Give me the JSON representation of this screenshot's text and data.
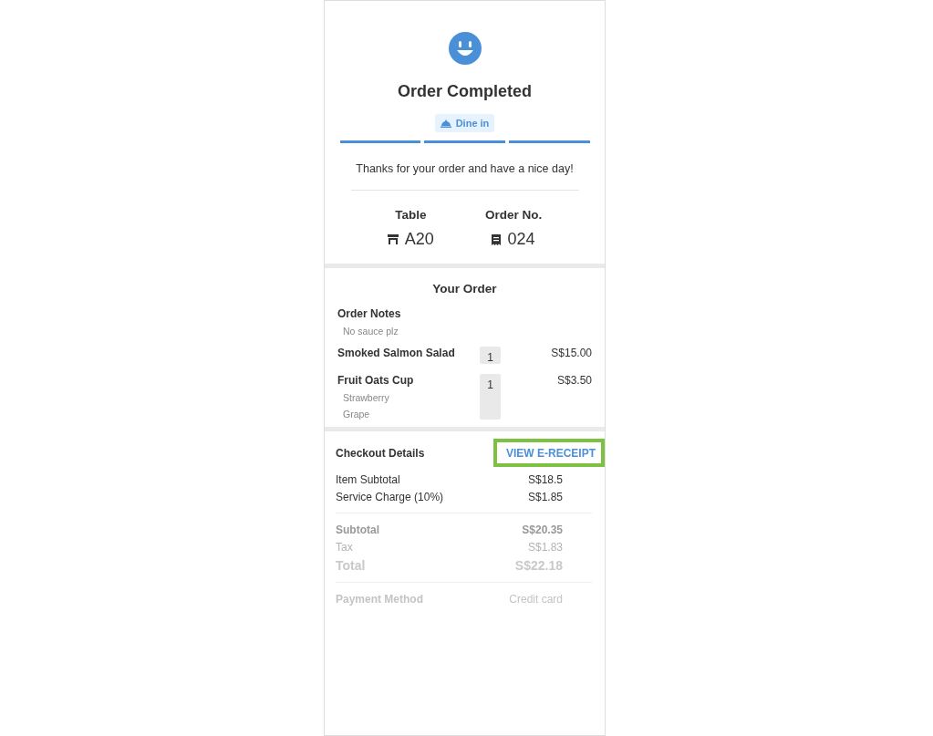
{
  "header": {
    "title": "Order Completed",
    "order_type": "Dine in",
    "steps": [
      {
        "done": true
      },
      {
        "done": true
      },
      {
        "done": true
      }
    ],
    "message": "Thanks for your order and have a nice day!"
  },
  "info": [
    {
      "kind": "table",
      "label": "Table",
      "value": "A20"
    },
    {
      "kind": "order",
      "label": "Order No.",
      "value": "024"
    }
  ],
  "order": {
    "title": "Your Order",
    "notes_label": "Order Notes",
    "notes": "No sauce plz",
    "items": [
      {
        "name": "Smoked Salmon Salad",
        "qty": "1",
        "price": "S$15.00"
      },
      {
        "name": "Fruit Oats Cup",
        "qty": "1",
        "price": "S$3.50",
        "options": [
          "Strawberry",
          "Grape"
        ]
      }
    ]
  },
  "checkout": {
    "title": "Checkout Details",
    "receipt_link": {
      "label": "VIEW E-RECEIPT",
      "highlighted": true
    },
    "lines": [
      {
        "label": "Item Subtotal",
        "value": "S$18.5"
      },
      {
        "label": "Service Charge (10%)",
        "value": "S$1.85"
      }
    ],
    "summary": [
      {
        "kind": "subtotal",
        "label": "Subtotal",
        "value": "S$20.35"
      },
      {
        "kind": "tax",
        "label": "Tax",
        "value": "S$1.83"
      },
      {
        "kind": "total",
        "label": "Total",
        "value": "S$22.18"
      },
      {
        "kind": "payment",
        "label": "Payment Method",
        "value": "Credit card"
      }
    ]
  }
}
